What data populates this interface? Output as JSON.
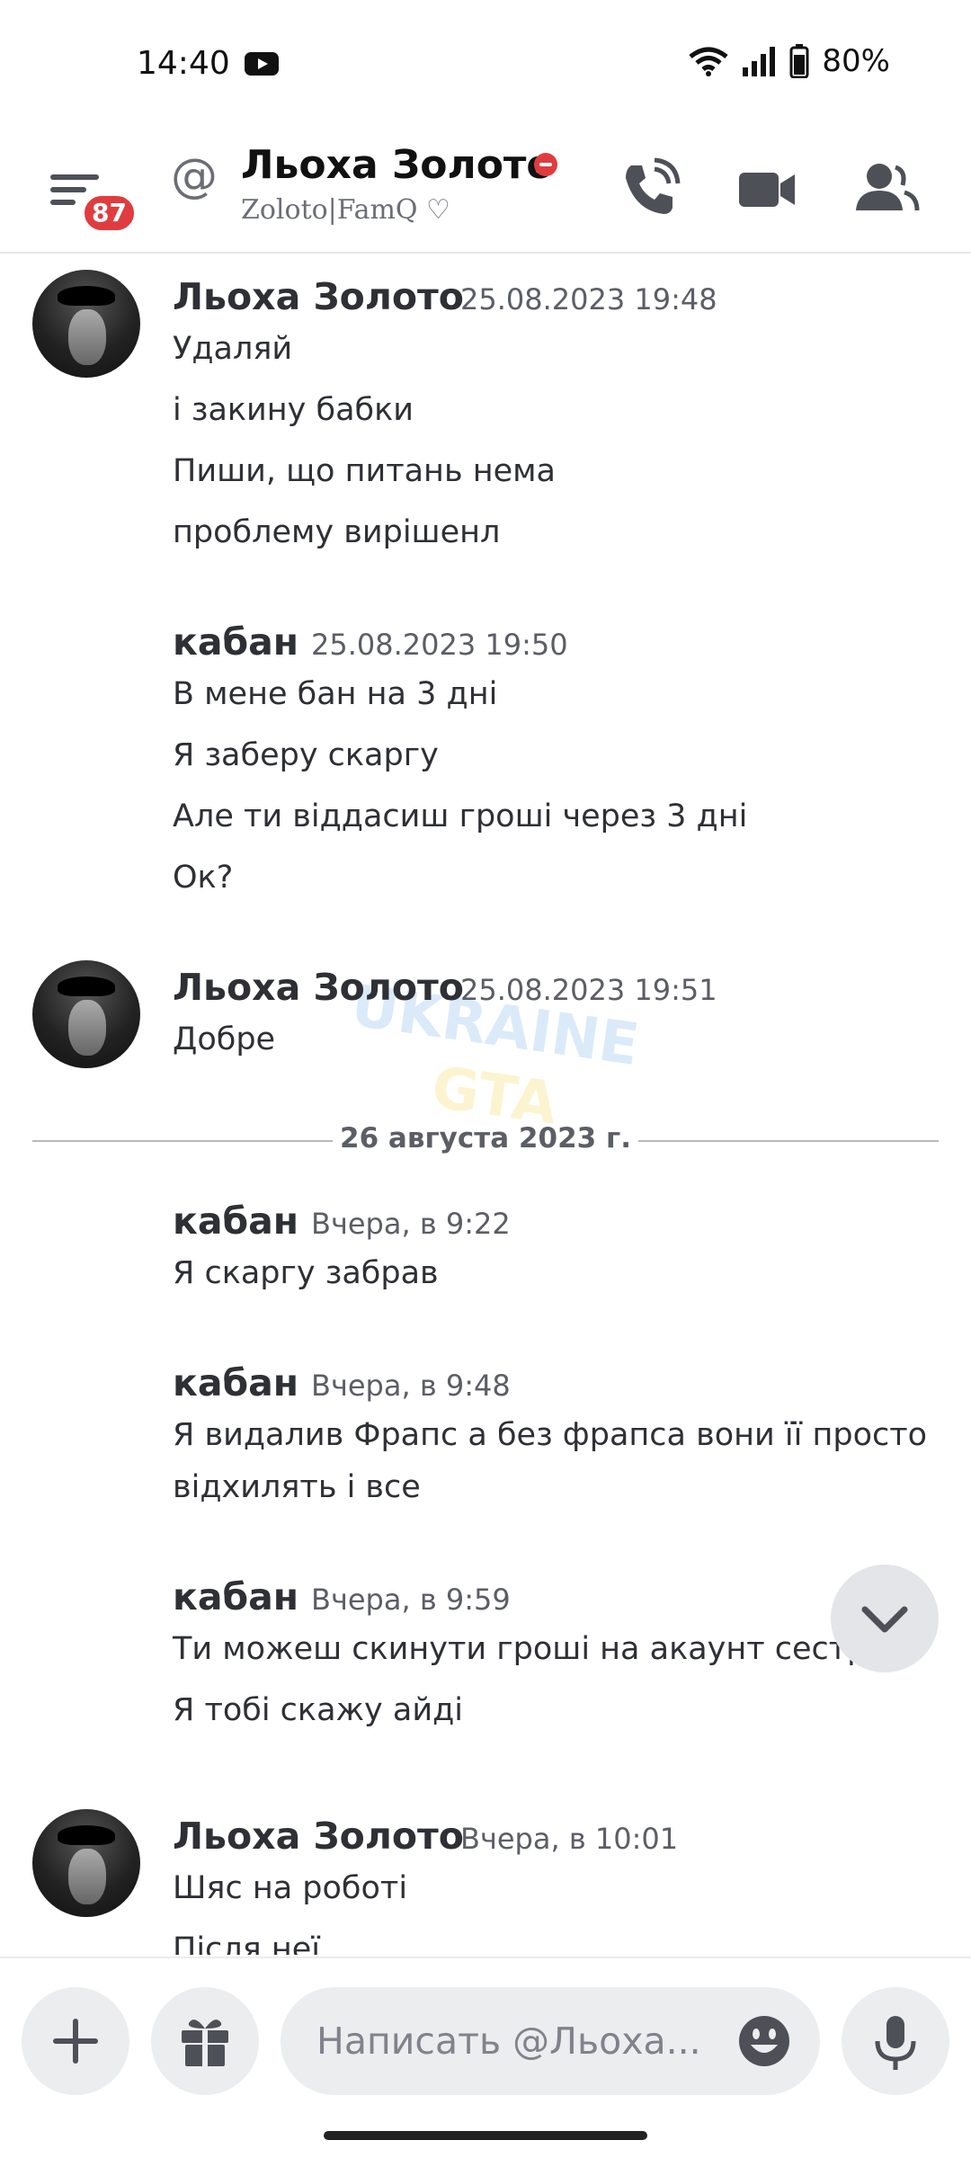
{
  "status_bar": {
    "time": "14:40",
    "battery": "80%"
  },
  "header": {
    "unread_count": "87",
    "at_symbol": "@",
    "name": "Льоха Золото",
    "custom_status": "Zoloto|FamQ ♡",
    "status_color": "#e03c3f"
  },
  "messages": [
    {
      "author": "Льоха Золото",
      "timestamp": "25.08.2023 19:48",
      "lines": [
        "Удаляй",
        "і закину бабки",
        "Пиши, що питань нема",
        "проблему вирішенл"
      ]
    },
    {
      "author": "кабан",
      "timestamp": "25.08.2023 19:50",
      "lines": [
        "В мене бан на 3 дні",
        "Я заберу скаргу",
        "Але ти віддасиш гроші через 3 дні",
        "Ок?"
      ]
    },
    {
      "author": "Льоха Золото",
      "timestamp": "25.08.2023 19:51",
      "lines": [
        "Добре"
      ]
    },
    {
      "author": "кабан",
      "timestamp": "Вчера, в 9:22",
      "lines": [
        "Я скаргу забрав"
      ]
    },
    {
      "author": "кабан",
      "timestamp": "Вчера, в 9:48",
      "lines": [
        "Я видалив Фрапс а без фрапса вони її просто",
        "відхилять і все"
      ]
    },
    {
      "author": "кабан",
      "timestamp": "Вчера, в 9:59",
      "lines": [
        "Ти можеш скинути гроші на акаунт сестрі?",
        "Я тобі скажу айді"
      ]
    },
    {
      "author": "Льоха Золото",
      "timestamp": "Вчера, в 10:01",
      "lines": [
        "Шяс на роботі",
        "Після неї"
      ]
    }
  ],
  "date_divider": "26 августа 2023 г.",
  "watermark": {
    "line1": "UKRAINE",
    "line2": "GTA"
  },
  "composer": {
    "placeholder": "Написать @Льоха..."
  },
  "colors": {
    "accent_red": "#e03c3f",
    "icon_gray": "#4e5058",
    "button_bg": "#ebedef"
  }
}
